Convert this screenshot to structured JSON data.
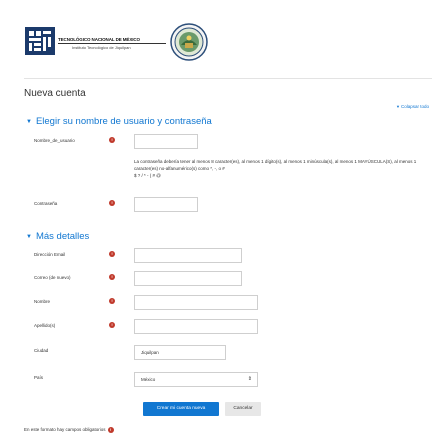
{
  "header": {
    "logo_line1": "TECNOLÓGICO NACIONAL DE MÉXICO",
    "logo_line2": "Instituto Tecnológico de Jiquilpan"
  },
  "page_title": "Nueva cuenta",
  "collapse_all": "Colapsar todo",
  "section_account": {
    "title": "Elegir su nombre de usuario y contraseña",
    "username_label": "Nombre_de_usuario",
    "username_value": "",
    "password_policy": "La contraseña debería tener al menos 8 caracter(es), al menos 1 dígito(s), al menos 1 minúscula(s), al menos 1 MAYÚSCULA(S), al menos 1 caracter(es) no-alfanumérico(s) como *, -, o #",
    "password_policy_example": "$ ? / *  - ( # @",
    "password_label": "Contraseña",
    "password_value": ""
  },
  "section_details": {
    "title": "Más detalles",
    "email_label": "Dirección Email",
    "email_value": "",
    "email_again_label": "Correo (de nuevo)",
    "email_again_value": "",
    "firstname_label": "Nombre",
    "firstname_value": "",
    "lastname_label": "Apellido(s)",
    "lastname_value": "",
    "city_label": "Ciudad",
    "city_value": "Jiquilpan",
    "country_label": "País",
    "country_value": "México"
  },
  "buttons": {
    "create": "Crear mi cuenta nueva",
    "cancel": "Cancelar"
  },
  "footnote": "En este formato hay campos obligatorios",
  "required_glyph": "!",
  "colors": {
    "accent": "#1177d1",
    "required": "#c0392b"
  }
}
